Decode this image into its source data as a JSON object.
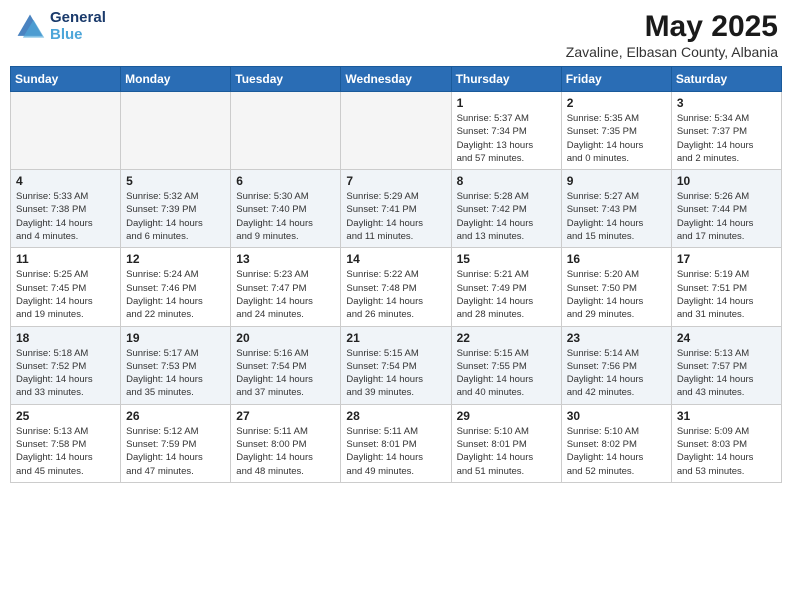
{
  "header": {
    "logo": {
      "line1": "General",
      "line2": "Blue"
    },
    "month_year": "May 2025",
    "location": "Zavaline, Elbasan County, Albania"
  },
  "weekdays": [
    "Sunday",
    "Monday",
    "Tuesday",
    "Wednesday",
    "Thursday",
    "Friday",
    "Saturday"
  ],
  "weeks": [
    [
      {
        "day": "",
        "info": ""
      },
      {
        "day": "",
        "info": ""
      },
      {
        "day": "",
        "info": ""
      },
      {
        "day": "",
        "info": ""
      },
      {
        "day": "1",
        "info": "Sunrise: 5:37 AM\nSunset: 7:34 PM\nDaylight: 13 hours\nand 57 minutes."
      },
      {
        "day": "2",
        "info": "Sunrise: 5:35 AM\nSunset: 7:35 PM\nDaylight: 14 hours\nand 0 minutes."
      },
      {
        "day": "3",
        "info": "Sunrise: 5:34 AM\nSunset: 7:37 PM\nDaylight: 14 hours\nand 2 minutes."
      }
    ],
    [
      {
        "day": "4",
        "info": "Sunrise: 5:33 AM\nSunset: 7:38 PM\nDaylight: 14 hours\nand 4 minutes."
      },
      {
        "day": "5",
        "info": "Sunrise: 5:32 AM\nSunset: 7:39 PM\nDaylight: 14 hours\nand 6 minutes."
      },
      {
        "day": "6",
        "info": "Sunrise: 5:30 AM\nSunset: 7:40 PM\nDaylight: 14 hours\nand 9 minutes."
      },
      {
        "day": "7",
        "info": "Sunrise: 5:29 AM\nSunset: 7:41 PM\nDaylight: 14 hours\nand 11 minutes."
      },
      {
        "day": "8",
        "info": "Sunrise: 5:28 AM\nSunset: 7:42 PM\nDaylight: 14 hours\nand 13 minutes."
      },
      {
        "day": "9",
        "info": "Sunrise: 5:27 AM\nSunset: 7:43 PM\nDaylight: 14 hours\nand 15 minutes."
      },
      {
        "day": "10",
        "info": "Sunrise: 5:26 AM\nSunset: 7:44 PM\nDaylight: 14 hours\nand 17 minutes."
      }
    ],
    [
      {
        "day": "11",
        "info": "Sunrise: 5:25 AM\nSunset: 7:45 PM\nDaylight: 14 hours\nand 19 minutes."
      },
      {
        "day": "12",
        "info": "Sunrise: 5:24 AM\nSunset: 7:46 PM\nDaylight: 14 hours\nand 22 minutes."
      },
      {
        "day": "13",
        "info": "Sunrise: 5:23 AM\nSunset: 7:47 PM\nDaylight: 14 hours\nand 24 minutes."
      },
      {
        "day": "14",
        "info": "Sunrise: 5:22 AM\nSunset: 7:48 PM\nDaylight: 14 hours\nand 26 minutes."
      },
      {
        "day": "15",
        "info": "Sunrise: 5:21 AM\nSunset: 7:49 PM\nDaylight: 14 hours\nand 28 minutes."
      },
      {
        "day": "16",
        "info": "Sunrise: 5:20 AM\nSunset: 7:50 PM\nDaylight: 14 hours\nand 29 minutes."
      },
      {
        "day": "17",
        "info": "Sunrise: 5:19 AM\nSunset: 7:51 PM\nDaylight: 14 hours\nand 31 minutes."
      }
    ],
    [
      {
        "day": "18",
        "info": "Sunrise: 5:18 AM\nSunset: 7:52 PM\nDaylight: 14 hours\nand 33 minutes."
      },
      {
        "day": "19",
        "info": "Sunrise: 5:17 AM\nSunset: 7:53 PM\nDaylight: 14 hours\nand 35 minutes."
      },
      {
        "day": "20",
        "info": "Sunrise: 5:16 AM\nSunset: 7:54 PM\nDaylight: 14 hours\nand 37 minutes."
      },
      {
        "day": "21",
        "info": "Sunrise: 5:15 AM\nSunset: 7:54 PM\nDaylight: 14 hours\nand 39 minutes."
      },
      {
        "day": "22",
        "info": "Sunrise: 5:15 AM\nSunset: 7:55 PM\nDaylight: 14 hours\nand 40 minutes."
      },
      {
        "day": "23",
        "info": "Sunrise: 5:14 AM\nSunset: 7:56 PM\nDaylight: 14 hours\nand 42 minutes."
      },
      {
        "day": "24",
        "info": "Sunrise: 5:13 AM\nSunset: 7:57 PM\nDaylight: 14 hours\nand 43 minutes."
      }
    ],
    [
      {
        "day": "25",
        "info": "Sunrise: 5:13 AM\nSunset: 7:58 PM\nDaylight: 14 hours\nand 45 minutes."
      },
      {
        "day": "26",
        "info": "Sunrise: 5:12 AM\nSunset: 7:59 PM\nDaylight: 14 hours\nand 47 minutes."
      },
      {
        "day": "27",
        "info": "Sunrise: 5:11 AM\nSunset: 8:00 PM\nDaylight: 14 hours\nand 48 minutes."
      },
      {
        "day": "28",
        "info": "Sunrise: 5:11 AM\nSunset: 8:01 PM\nDaylight: 14 hours\nand 49 minutes."
      },
      {
        "day": "29",
        "info": "Sunrise: 5:10 AM\nSunset: 8:01 PM\nDaylight: 14 hours\nand 51 minutes."
      },
      {
        "day": "30",
        "info": "Sunrise: 5:10 AM\nSunset: 8:02 PM\nDaylight: 14 hours\nand 52 minutes."
      },
      {
        "day": "31",
        "info": "Sunrise: 5:09 AM\nSunset: 8:03 PM\nDaylight: 14 hours\nand 53 minutes."
      }
    ]
  ]
}
